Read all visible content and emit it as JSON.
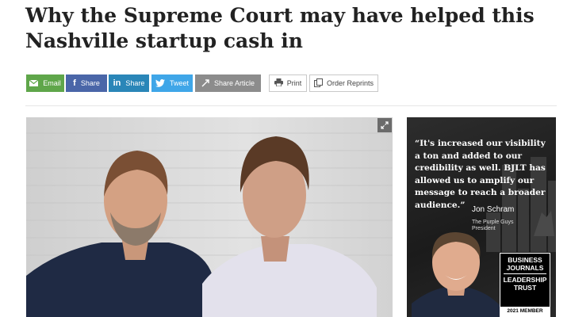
{
  "article": {
    "headline": "Why the Supreme Court may have helped this Nashville startup cash in"
  },
  "share": {
    "email_label": "Email",
    "facebook_label": "Share",
    "linkedin_label": "Share",
    "twitter_label": "Tweet",
    "share_article_label": "Share Article",
    "print_label": "Print",
    "reprints_label": "Order Reprints"
  },
  "icons": {
    "email": "envelope-icon",
    "facebook": "facebook-icon",
    "linkedin": "linkedin-icon",
    "twitter": "twitter-icon",
    "share": "share-icon",
    "print": "printer-icon",
    "reprints": "reprints-icon",
    "expand": "expand-icon"
  },
  "ad": {
    "quote": "“It's increased our visibility a ton and added to our credibility as well. BJLT has allowed us to amplify our message to reach a broader audience.”",
    "name": "Jon Schram",
    "company_line1": "The Purple Guys",
    "company_line2": "President",
    "badge_line1": "BUSINESS",
    "badge_line2": "JOURNALS",
    "badge_line3": "LEADERSHIP",
    "badge_line4": "TRUST",
    "badge_year": "2021 MEMBER"
  },
  "colors": {
    "email": "#5fa64a",
    "facebook": "#4a66a8",
    "linkedin": "#2a86b8",
    "twitter": "#3fa6e8",
    "share_article": "#8c8c8c",
    "headline": "#222222"
  }
}
